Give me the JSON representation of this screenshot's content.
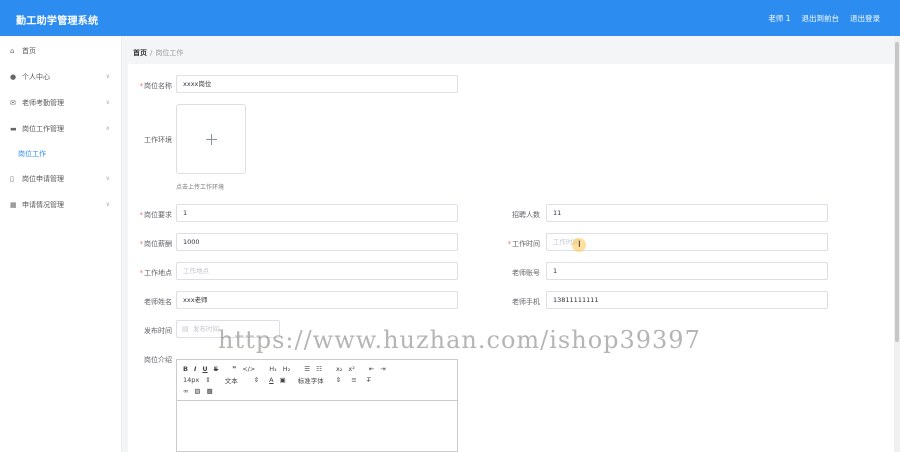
{
  "header": {
    "title": "勤工助学管理系统",
    "user": "老师 1",
    "back_to_admin": "退出到前台",
    "logout": "退出登录"
  },
  "sidebar": {
    "items": [
      {
        "label": "首页",
        "icon": "home-icon"
      },
      {
        "label": "个人中心",
        "icon": "user-icon"
      },
      {
        "label": "老师考勤管理",
        "icon": "mail-icon"
      },
      {
        "label": "岗位工作管理",
        "icon": "briefcase-icon"
      },
      {
        "label": "岗位申请管理",
        "icon": "phone-icon"
      },
      {
        "label": "申请情况管理",
        "icon": "building-icon"
      }
    ],
    "sub_item": "岗位工作"
  },
  "breadcrumb": {
    "home": "首页",
    "separator": "/",
    "current": "岗位工作"
  },
  "form": {
    "job_name": {
      "label": "岗位名称",
      "value": "xxxx岗位"
    },
    "work_env": {
      "label": "工作环境",
      "tip": "点击上传工作环境"
    },
    "job_requirement": {
      "label": "岗位要求",
      "value": "1"
    },
    "recruit_count": {
      "label": "招聘人数",
      "value": "11"
    },
    "job_salary": {
      "label": "岗位薪酬",
      "value": "1000"
    },
    "work_time": {
      "label": "工作时间",
      "placeholder": "工作时间"
    },
    "work_location": {
      "label": "工作地点",
      "placeholder": "工作地点"
    },
    "teacher_account": {
      "label": "老师账号",
      "value": "1"
    },
    "teacher_name": {
      "label": "老师姓名",
      "value": "xxx老师"
    },
    "teacher_phone": {
      "label": "老师手机",
      "value": "13811111111"
    },
    "publish_time": {
      "label": "发布时间",
      "placeholder": "发布时间"
    },
    "job_intro": {
      "label": "岗位介绍"
    }
  },
  "editor": {
    "font_size": "14px",
    "text_style": "文本",
    "font_family": "标准字体"
  },
  "watermark": "https://www.huzhan.com/ishop39397",
  "colors": {
    "header_bg": "#2d8cf0",
    "active_menu": "#2d8cf0",
    "required_mark": "#f56c6c"
  }
}
